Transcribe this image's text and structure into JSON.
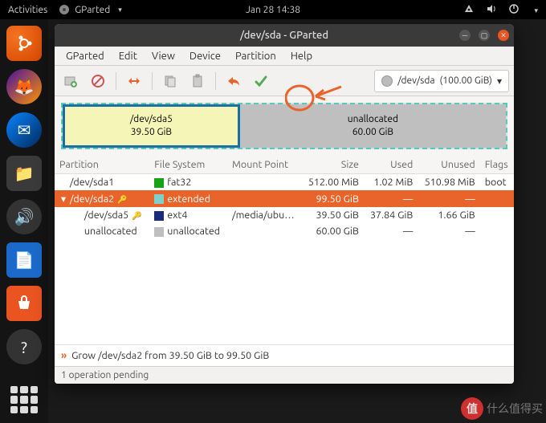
{
  "panel": {
    "activities": "Activities",
    "app_name": "GParted",
    "clock": "Jan 28  14:38"
  },
  "window": {
    "title": "/dev/sda - GParted"
  },
  "menubar": [
    "GParted",
    "Edit",
    "View",
    "Device",
    "Partition",
    "Help"
  ],
  "device_selector": {
    "name": "/dev/sda",
    "size": "(100.00 GiB)"
  },
  "diagram": {
    "sda5": {
      "name": "/dev/sda5",
      "size": "39.50 GiB"
    },
    "unalloc": {
      "name": "unallocated",
      "size": "60.00 GiB"
    }
  },
  "columns": [
    "Partition",
    "File System",
    "Mount Point",
    "Size",
    "Used",
    "Unused",
    "Flags"
  ],
  "rows": [
    {
      "indent": 0,
      "caret": "",
      "name": "/dev/sda1",
      "key": false,
      "fs": "fat32",
      "fs_color": "#16a316",
      "mount": "",
      "size": "512.00 MiB",
      "used": "1.02 MiB",
      "unused": "510.98 MiB",
      "flags": "boot",
      "selected": false
    },
    {
      "indent": 0,
      "caret": "▾",
      "name": "/dev/sda2",
      "key": true,
      "fs": "extended",
      "fs_color": "#7fd0c9",
      "mount": "",
      "size": "99.50 GiB",
      "used": "—",
      "unused": "—",
      "flags": "",
      "selected": true
    },
    {
      "indent": 1,
      "caret": "",
      "name": "/dev/sda5",
      "key": true,
      "fs": "ext4",
      "fs_color": "#1a2a7c",
      "mount": "/media/ubu…",
      "size": "39.50 GiB",
      "used": "37.84 GiB",
      "unused": "1.66 GiB",
      "flags": "",
      "selected": false
    },
    {
      "indent": 1,
      "caret": "",
      "name": "unallocated",
      "key": false,
      "fs": "unallocated",
      "fs_color": "#bfbfbf",
      "mount": "",
      "size": "60.00 GiB",
      "used": "—",
      "unused": "—",
      "flags": "",
      "selected": false
    }
  ],
  "pending_op": "Grow /dev/sda2 from 39.50 GiB to 99.50 GiB",
  "statusbar": "1 operation pending",
  "watermark": {
    "badge": "值",
    "text": "什么值得买"
  }
}
